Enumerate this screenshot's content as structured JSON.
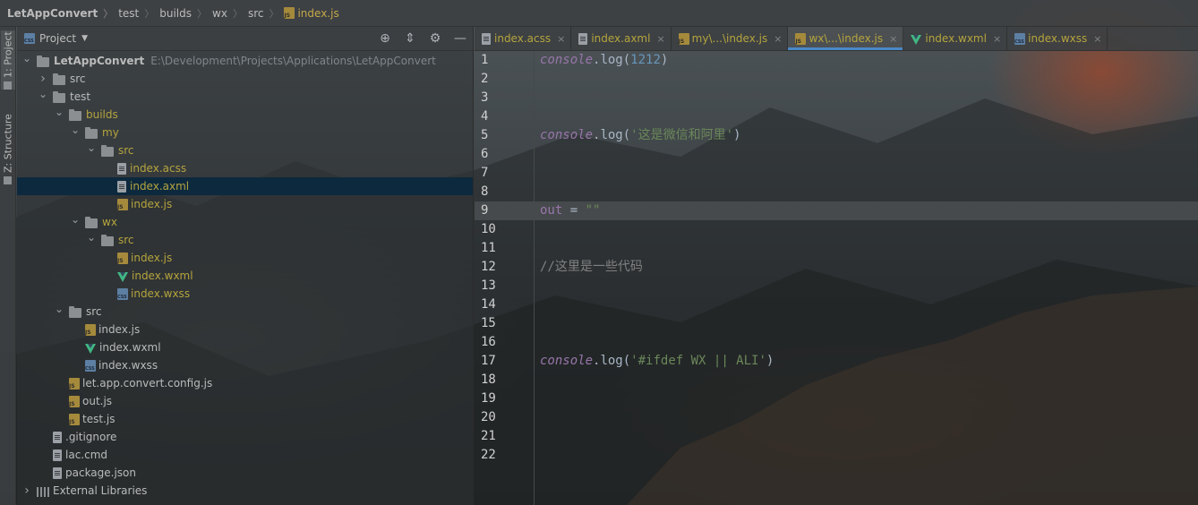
{
  "breadcrumb": [
    "LetAppConvert",
    "test",
    "builds",
    "wx",
    "src",
    "index.js"
  ],
  "sidebar_strip": {
    "project_label": "1: Project",
    "structure_label": "Z: Structure"
  },
  "project_panel": {
    "title": "Project",
    "rows": [
      {
        "label": "LetAppConvert",
        "path": "E:\\Development\\Projects\\Applications\\LetAppConvert",
        "depth": 0,
        "arrow": "down",
        "icon": "folder",
        "bold": true
      },
      {
        "label": "src",
        "depth": 1,
        "arrow": "right",
        "icon": "folder"
      },
      {
        "label": "test",
        "depth": 1,
        "arrow": "down",
        "icon": "folder"
      },
      {
        "label": "builds",
        "depth": 2,
        "arrow": "down",
        "icon": "folder",
        "yellow": true
      },
      {
        "label": "my",
        "depth": 3,
        "arrow": "down",
        "icon": "folder",
        "yellow": true
      },
      {
        "label": "src",
        "depth": 4,
        "arrow": "down",
        "icon": "folder",
        "yellow": true
      },
      {
        "label": "index.acss",
        "depth": 5,
        "icon": "file",
        "yellow": true
      },
      {
        "label": "index.axml",
        "depth": 5,
        "icon": "file",
        "yellow": true,
        "selected": true
      },
      {
        "label": "index.js",
        "depth": 5,
        "icon": "js",
        "yellow": true
      },
      {
        "label": "wx",
        "depth": 3,
        "arrow": "down",
        "icon": "folder",
        "yellow": true
      },
      {
        "label": "src",
        "depth": 4,
        "arrow": "down",
        "icon": "folder",
        "yellow": true
      },
      {
        "label": "index.js",
        "depth": 5,
        "icon": "js",
        "yellow": true
      },
      {
        "label": "index.wxml",
        "depth": 5,
        "icon": "vue",
        "yellow": true
      },
      {
        "label": "index.wxss",
        "depth": 5,
        "icon": "css",
        "yellow": true
      },
      {
        "label": "src",
        "depth": 2,
        "arrow": "down",
        "icon": "folder"
      },
      {
        "label": "index.js",
        "depth": 3,
        "icon": "js"
      },
      {
        "label": "index.wxml",
        "depth": 3,
        "icon": "vue"
      },
      {
        "label": "index.wxss",
        "depth": 3,
        "icon": "css"
      },
      {
        "label": "let.app.convert.config.js",
        "depth": 2,
        "icon": "js"
      },
      {
        "label": "out.js",
        "depth": 2,
        "icon": "js"
      },
      {
        "label": "test.js",
        "depth": 2,
        "icon": "js"
      },
      {
        "label": ".gitignore",
        "depth": 1,
        "icon": "file"
      },
      {
        "label": "lac.cmd",
        "depth": 1,
        "icon": "file"
      },
      {
        "label": "package.json",
        "depth": 1,
        "icon": "file"
      },
      {
        "label": "External Libraries",
        "depth": 0,
        "arrow": "right",
        "icon": "lib"
      }
    ]
  },
  "editor": {
    "tabs": [
      {
        "label": "index.acss",
        "icon": "file"
      },
      {
        "label": "index.axml",
        "icon": "file"
      },
      {
        "label": "my\\...\\index.js",
        "icon": "js"
      },
      {
        "label": "wx\\...\\index.js",
        "icon": "js",
        "active": true
      },
      {
        "label": "index.wxml",
        "icon": "vue"
      },
      {
        "label": "index.wxss",
        "icon": "css"
      }
    ],
    "current_line": 9,
    "lines": [
      [
        {
          "t": "console",
          "c": "obj"
        },
        {
          "t": ".log(",
          "c": "fn"
        },
        {
          "t": "1212",
          "c": "num"
        },
        {
          "t": ")",
          "c": "fn"
        }
      ],
      [],
      [],
      [],
      [
        {
          "t": "console",
          "c": "obj"
        },
        {
          "t": ".log(",
          "c": "fn"
        },
        {
          "t": "'这是微信和阿里'",
          "c": "str"
        },
        {
          "t": ")",
          "c": "fn"
        }
      ],
      [],
      [],
      [],
      [
        {
          "t": "out",
          "c": "var"
        },
        {
          "t": " = ",
          "c": "fn"
        },
        {
          "t": "\"\"",
          "c": "str"
        }
      ],
      [],
      [],
      [
        {
          "t": "//这里是一些代码",
          "c": "com"
        }
      ],
      [],
      [],
      [],
      [],
      [
        {
          "t": "console",
          "c": "obj"
        },
        {
          "t": ".log(",
          "c": "fn"
        },
        {
          "t": "'#ifdef WX || ALI'",
          "c": "str"
        },
        {
          "t": ")",
          "c": "fn"
        }
      ],
      [],
      [],
      [],
      [],
      []
    ]
  }
}
